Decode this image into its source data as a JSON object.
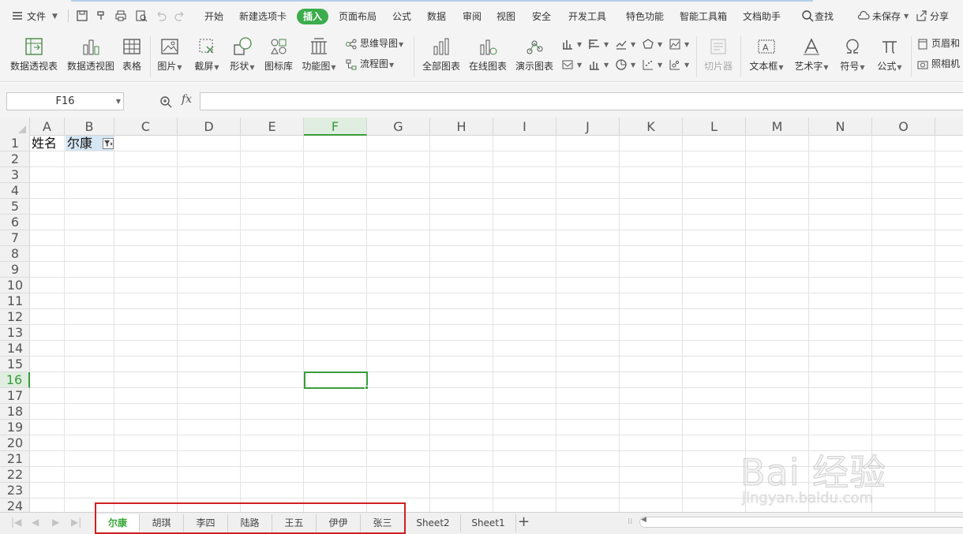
{
  "menubar": {
    "file": "文件",
    "tabs": [
      "开始",
      "新建选项卡",
      "插入",
      "页面布局",
      "公式",
      "数据",
      "审阅",
      "视图",
      "安全",
      "开发工具",
      "特色功能",
      "智能工具箱",
      "文档助手"
    ],
    "active_tab": "插入",
    "search": "查找",
    "unsaved": "未保存",
    "share": "分享"
  },
  "ribbon": {
    "pivot_table": "数据透视表",
    "pivot_chart": "数据透视图",
    "table": "表格",
    "picture": "图片",
    "screenshot": "截屏",
    "shapes": "形状",
    "icon_lib": "图标库",
    "func_chart": "功能图",
    "mindmap": "思维导图",
    "flowchart": "流程图",
    "all_charts": "全部图表",
    "online_charts": "在线图表",
    "demo_charts": "演示图表",
    "slicer": "切片器",
    "textbox": "文本框",
    "wordart": "艺术字",
    "symbol": "符号",
    "formula": "公式",
    "header_footer": "页眉和",
    "camera": "照相机"
  },
  "formula_bar": {
    "name_box": "F16",
    "fx": "fx",
    "value": ""
  },
  "grid": {
    "columns": [
      "A",
      "B",
      "C",
      "D",
      "E",
      "F",
      "G",
      "H",
      "I",
      "J",
      "K",
      "L",
      "M",
      "N",
      "O"
    ],
    "rows": [
      "1",
      "2",
      "3",
      "4",
      "5",
      "6",
      "7",
      "8",
      "9",
      "10",
      "11",
      "12",
      "13",
      "14",
      "15",
      "16",
      "17",
      "18",
      "19",
      "20",
      "21",
      "22",
      "23",
      "24"
    ],
    "selected_column": "F",
    "selected_row": "16",
    "cells": {
      "A1": "姓名",
      "B1": "尔康"
    }
  },
  "sheets": {
    "tabs": [
      "尔康",
      "胡琪",
      "李四",
      "陆路",
      "王五",
      "伊伊",
      "张三",
      "Sheet2",
      "Sheet1"
    ],
    "active": "尔康",
    "add": "+"
  },
  "watermark": {
    "text": "Bai 经验",
    "sub": "jingyan.baidu.com"
  },
  "colors": {
    "accent_green": "#3cac4c",
    "highlight_red": "#d02020",
    "selection_green": "#3a9c3a"
  }
}
